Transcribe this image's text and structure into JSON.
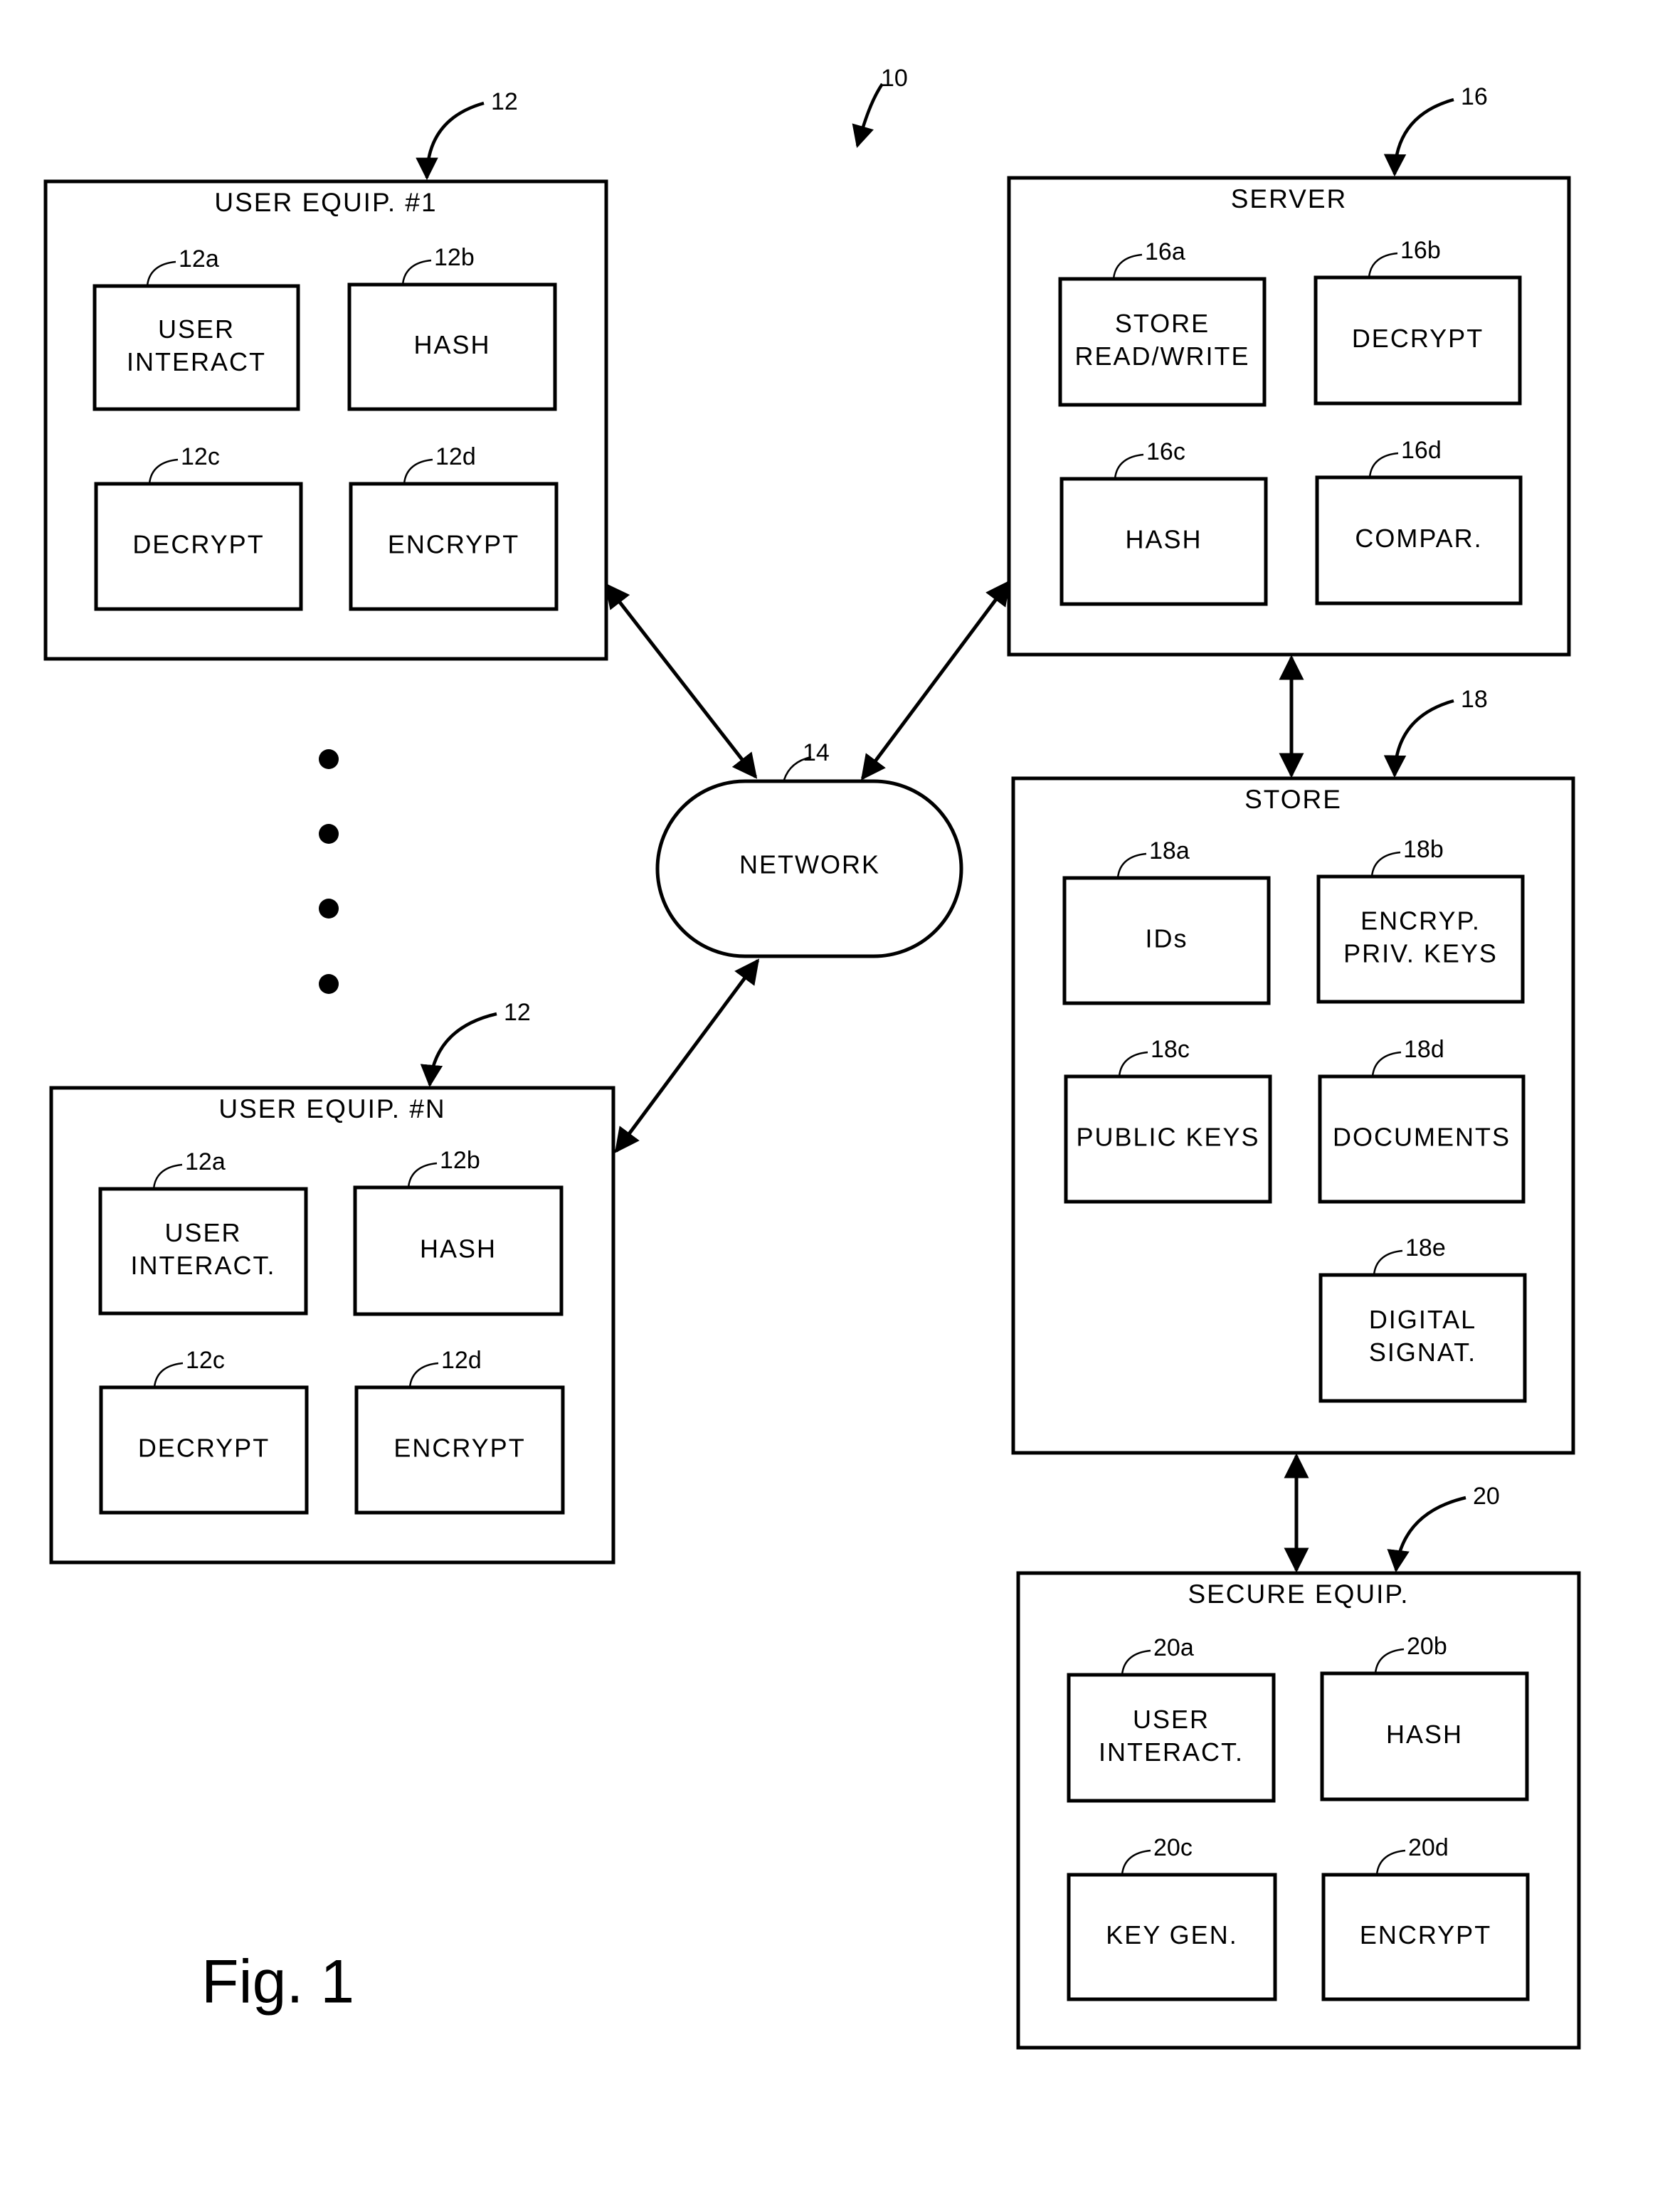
{
  "figure": {
    "label": "Fig. 1",
    "system_ref": "10"
  },
  "user_equip_1": {
    "title": "USER EQUIP. #1",
    "ref": "12",
    "modules": [
      {
        "ref": "12a",
        "lines": [
          "USER",
          "INTERACT"
        ]
      },
      {
        "ref": "12b",
        "lines": [
          "HASH"
        ]
      },
      {
        "ref": "12c",
        "lines": [
          "DECRYPT"
        ]
      },
      {
        "ref": "12d",
        "lines": [
          "ENCRYPT"
        ]
      }
    ]
  },
  "user_equip_n": {
    "title": "USER EQUIP. #N",
    "ref": "12",
    "modules": [
      {
        "ref": "12a",
        "lines": [
          "USER",
          "INTERACT."
        ]
      },
      {
        "ref": "12b",
        "lines": [
          "HASH"
        ]
      },
      {
        "ref": "12c",
        "lines": [
          "DECRYPT"
        ]
      },
      {
        "ref": "12d",
        "lines": [
          "ENCRYPT"
        ]
      }
    ]
  },
  "network": {
    "label": "NETWORK",
    "ref": "14"
  },
  "server": {
    "title": "SERVER",
    "ref": "16",
    "modules": [
      {
        "ref": "16a",
        "lines": [
          "STORE",
          "READ/WRITE"
        ]
      },
      {
        "ref": "16b",
        "lines": [
          "DECRYPT"
        ]
      },
      {
        "ref": "16c",
        "lines": [
          "HASH"
        ]
      },
      {
        "ref": "16d",
        "lines": [
          "COMPAR."
        ]
      }
    ]
  },
  "store": {
    "title": "STORE",
    "ref": "18",
    "modules": [
      {
        "ref": "18a",
        "lines": [
          "IDs"
        ]
      },
      {
        "ref": "18b",
        "lines": [
          "ENCRYP.",
          "PRIV. KEYS"
        ]
      },
      {
        "ref": "18c",
        "lines": [
          "PUBLIC KEYS"
        ]
      },
      {
        "ref": "18d",
        "lines": [
          "DOCUMENTS"
        ]
      },
      {
        "ref": "18e",
        "lines": [
          "DIGITAL",
          "SIGNAT."
        ]
      }
    ]
  },
  "secure_equip": {
    "title": "SECURE EQUIP.",
    "ref": "20",
    "modules": [
      {
        "ref": "20a",
        "lines": [
          "USER",
          "INTERACT."
        ]
      },
      {
        "ref": "20b",
        "lines": [
          "HASH"
        ]
      },
      {
        "ref": "20c",
        "lines": [
          "KEY GEN."
        ]
      },
      {
        "ref": "20d",
        "lines": [
          "ENCRYPT"
        ]
      }
    ]
  },
  "ellipsis_dots": 4
}
